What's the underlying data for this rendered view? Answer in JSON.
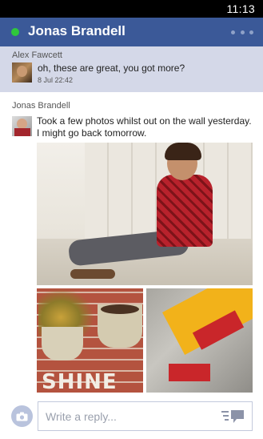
{
  "status_bar": {
    "time": "11:13"
  },
  "header": {
    "title": "Jonas Brandell",
    "presence_color": "#2fc83b",
    "accent": "#3b5998"
  },
  "messages": [
    {
      "sender": "Alex Fawcett",
      "text": "oh, these are great, you got more?",
      "time": "8 Jul 22:42"
    },
    {
      "sender": "Jonas Brandell",
      "text": "Took a few photos whilst out on the wall yesterday. I might go back tomorrow."
    }
  ],
  "photos": [
    {
      "icon": "photo-person-wall"
    },
    {
      "icon": "photo-potted-plants",
      "caption_text": "SHINE"
    },
    {
      "icon": "photo-painted-arrow"
    }
  ],
  "reply": {
    "placeholder": "Write a reply...",
    "value": ""
  },
  "icons": {
    "camera": "camera-icon",
    "send": "send-icon",
    "more": "more-icon",
    "presence": "online-dot-icon"
  }
}
